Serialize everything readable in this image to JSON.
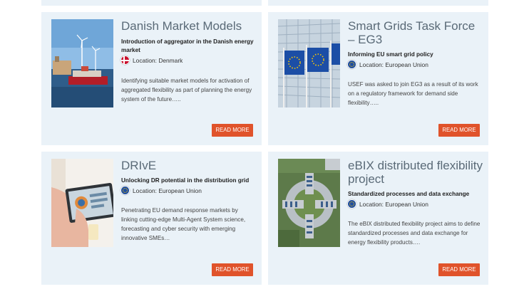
{
  "cards": [
    {
      "title": "Danish Market Models",
      "subtitle": "Introduction of aggregator in the Danish energy market",
      "location": "Location: Denmark",
      "flag": "denmark-flag",
      "description": "Identifying suitable market models for activation of aggregated flexibility as part of planning the energy system of the future…..",
      "button": "READ MORE"
    },
    {
      "title": "Smart Grids Task Force – EG3",
      "subtitle": "Informing EU smart grid policy",
      "location": "Location: European Union",
      "flag": "eu-flag",
      "description": "USEF was asked to join EG3 as a result of its work on a regulatory framework for demand side flexibility…..",
      "button": "READ MORE"
    },
    {
      "title": "DRIvE",
      "subtitle": "Unlocking DR potential in the distribution grid",
      "location": "Location: European Union",
      "flag": "eu-flag",
      "description": "Penetrating EU demand response markets by linking cutting-edge Multi-Agent System science, forecasting and cyber security with emerging innovative SMEs…",
      "button": "READ MORE"
    },
    {
      "title": "eBIX distributed flexibility project",
      "subtitle": "Standardized processes and data exchange",
      "location": "Location: European Union",
      "flag": "eu-flag",
      "description": "The eBIX distributed flexibility project aims to define standardized processes and data exchange for energy flexibility products….",
      "button": "READ MORE"
    }
  ],
  "colors": {
    "card_bg": "#eaf2f8",
    "button_bg": "#e0532b",
    "title_color": "#5a6a77"
  }
}
